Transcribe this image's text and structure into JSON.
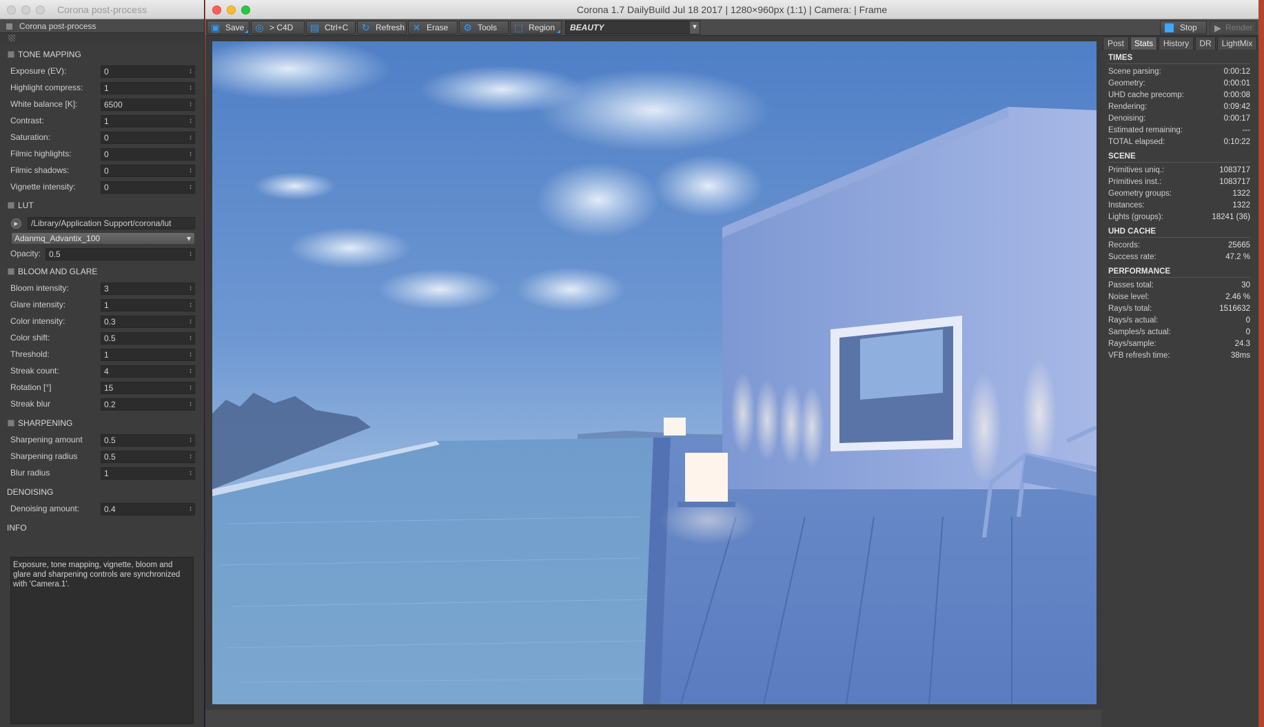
{
  "left_window": {
    "title": "Corona post-process",
    "header": "Corona post-process",
    "sections": {
      "tone_mapping": "TONE MAPPING",
      "lut": "LUT",
      "bloom": "BLOOM AND GLARE",
      "sharpening": "SHARPENING",
      "denoising": "DENOISING",
      "info": "INFO"
    },
    "tone": [
      {
        "label": "Exposure (EV):",
        "value": "0"
      },
      {
        "label": "Highlight compress:",
        "value": "1"
      },
      {
        "label": "White balance [K]:",
        "value": "6500"
      },
      {
        "label": "Contrast:",
        "value": "1"
      },
      {
        "label": "Saturation:",
        "value": "0"
      },
      {
        "label": "Filmic highlights:",
        "value": "0"
      },
      {
        "label": "Filmic shadows:",
        "value": "0"
      },
      {
        "label": "Vignette intensity:",
        "value": "0"
      }
    ],
    "lut": {
      "path": "/Library/Application Support/corona/lut",
      "selected": "Adanmq_Advantix_100",
      "opacity_label": "Opacity:",
      "opacity": "0.5"
    },
    "bloom": [
      {
        "label": "Bloom intensity:",
        "value": "3"
      },
      {
        "label": "Glare intensity:",
        "value": "1"
      },
      {
        "label": "Color intensity:",
        "value": "0.3"
      },
      {
        "label": "Color shift:",
        "value": "0.5"
      },
      {
        "label": "Threshold:",
        "value": "1"
      },
      {
        "label": "Streak count:",
        "value": "4"
      },
      {
        "label": "Rotation [°]",
        "value": "15"
      },
      {
        "label": "Streak blur",
        "value": "0.2"
      }
    ],
    "sharpening": [
      {
        "label": "Sharpening amount",
        "value": "0.5"
      },
      {
        "label": "Sharpening radius",
        "value": "0.5"
      },
      {
        "label": "Blur radius",
        "value": "1"
      }
    ],
    "denoising": [
      {
        "label": "Denoising amount:",
        "value": "0.4"
      }
    ],
    "info_text": "Exposure, tone mapping, vignette, bloom and glare and sharpening controls are synchronized with 'Camera.1'."
  },
  "main_window": {
    "title": "Corona 1.7 DailyBuild Jul 18 2017 | 1280×960px (1:1) | Camera:  | Frame",
    "toolbar": {
      "save": "Save",
      "c4d": "> C4D",
      "ctrlc": "Ctrl+C",
      "refresh": "Refresh",
      "erase": "Erase",
      "tools": "Tools",
      "region": "Region",
      "pass": "BEAUTY",
      "stop": "Stop",
      "render": "Render"
    },
    "tabs": [
      "Post",
      "Stats",
      "History",
      "DR",
      "LightMix"
    ],
    "active_tab": "Stats",
    "stats": {
      "times_h": "TIMES",
      "times": [
        {
          "k": "Scene parsing:",
          "v": "0:00:12"
        },
        {
          "k": "Geometry:",
          "v": "0:00:01"
        },
        {
          "k": "UHD cache precomp:",
          "v": "0:00:08"
        },
        {
          "k": "Rendering:",
          "v": "0:09:42"
        },
        {
          "k": "Denoising:",
          "v": "0:00:17"
        },
        {
          "k": "Estimated remaining:",
          "v": "---"
        },
        {
          "k": "TOTAL elapsed:",
          "v": "0:10:22"
        }
      ],
      "scene_h": "SCENE",
      "scene": [
        {
          "k": "Primitives uniq.:",
          "v": "1083717"
        },
        {
          "k": "Primitives inst.:",
          "v": "1083717"
        },
        {
          "k": "Geometry groups:",
          "v": "1322"
        },
        {
          "k": "Instances:",
          "v": "1322"
        },
        {
          "k": "Lights (groups):",
          "v": "18241 (36)"
        }
      ],
      "uhd_h": "UHD CACHE",
      "uhd": [
        {
          "k": "Records:",
          "v": "25665"
        },
        {
          "k": "Success rate:",
          "v": "47.2 %"
        }
      ],
      "perf_h": "PERFORMANCE",
      "perf": [
        {
          "k": "Passes total:",
          "v": "30"
        },
        {
          "k": "Noise level:",
          "v": "2.46 %"
        },
        {
          "k": "Rays/s total:",
          "v": "1516632"
        },
        {
          "k": "Rays/s actual:",
          "v": "0"
        },
        {
          "k": "Samples/s actual:",
          "v": "0"
        },
        {
          "k": "Rays/sample:",
          "v": "24.3"
        },
        {
          "k": "VFB refresh time:",
          "v": "38ms"
        }
      ]
    }
  },
  "colors": {
    "accent": "#2f9bff",
    "panel_bg": "#3c3c3c",
    "field_bg": "#2c2c2c"
  }
}
